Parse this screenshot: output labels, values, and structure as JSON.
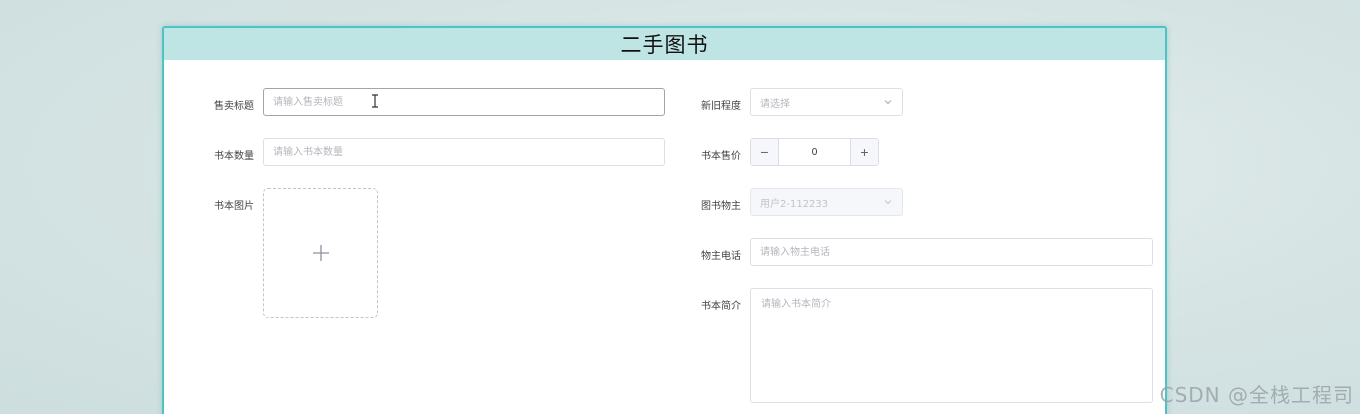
{
  "header": {
    "title": "二手图书"
  },
  "form": {
    "title": {
      "label": "售卖标题",
      "placeholder": "请输入售卖标题"
    },
    "condition": {
      "label": "新旧程度",
      "placeholder": "请选择"
    },
    "quantity": {
      "label": "书本数量",
      "placeholder": "请输入书本数量"
    },
    "price": {
      "label": "书本售价",
      "value": "0",
      "minus": "−",
      "plus": "+"
    },
    "image": {
      "label": "书本图片",
      "plus": "+"
    },
    "owner": {
      "label": "图书物主",
      "value": "用户2-112233"
    },
    "phone": {
      "label": "物主电话",
      "placeholder": "请输入物主电话"
    },
    "intro": {
      "label": "书本简介",
      "placeholder": "请输入书本简介"
    }
  },
  "watermark": "CSDN @全栈工程司",
  "colors": {
    "header_bg": "#bfe4e4",
    "card_border": "#4fc3c3"
  }
}
